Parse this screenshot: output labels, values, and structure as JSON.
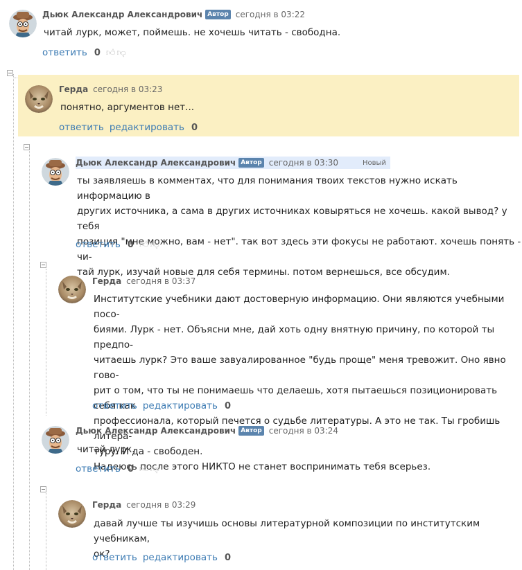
{
  "labels": {
    "reply": "ответить",
    "edit": "редактировать",
    "author_badge": "Автор",
    "new_badge": "Новый"
  },
  "colors": {
    "highlight": "#fbf0c3",
    "new_highlight": "#e2ecfb",
    "link": "#3c7bb3",
    "badge": "#5b84ad"
  },
  "icons": {
    "like": "thumbs-up-icon",
    "dislike": "thumbs-down-icon",
    "collapse": "collapse-minus-icon"
  },
  "comments": [
    {
      "author": "Дьюк Александр Александрович",
      "time": "сегодня в 03:22",
      "text": "читай лурк, может, поймешь. не хочешь читать - свободна.",
      "score": "0"
    },
    {
      "author": "Герда",
      "time": "сегодня в 03:23",
      "text": "понятно, аргументов нет...",
      "score": "0"
    },
    {
      "author": "Дьюк Александр Александрович",
      "time": "сегодня в 03:30",
      "text": "ты заявляешь в комментах, что для понимания твоих текстов нужно искать информацию в\nдругих источника, а сама в других источниках ковыряться не хочешь. какой вывод? у тебя\nпозиция \"мне можно, вам - нет\". так вот здесь эти фокусы не работают. хочешь понять - чи-\nтай лурк, изучай новые для себя термины. потом вернешься, все обсудим.",
      "score": "0"
    },
    {
      "author": "Герда",
      "time": "сегодня в 03:37",
      "text": "Институтские учебники дают достоверную информацию. Они являются учебными посо-\nбиями.  Лурк - нет.  Объясни мне, дай хоть одну внятную причину, по которой ты предпо-\nчитаешь лурк? Это ваше  завуалированное \"будь проще\" меня тревожит. Оно явно гово-\nрит о том, что ты не понимаешь что делаешь, хотя пытаешься позиционировать себя как\nпрофессионала, который печется о судьбе литературы. А это не так. Ты гробишь литера-\nтуру. И да - свободен.\nНадеюсь после этого НИКТО не станет воспринимать тебя всерьез.",
      "score": "0"
    },
    {
      "author": "Дьюк Александр Александрович",
      "time": "сегодня в 03:24",
      "text": "читай лурк.",
      "score": "0"
    },
    {
      "author": "Герда",
      "time": "сегодня в 03:29",
      "text": "давай  лучше ты изучишь основы литературной композиции по институтским учебникам,\nок?",
      "score": "0"
    }
  ]
}
